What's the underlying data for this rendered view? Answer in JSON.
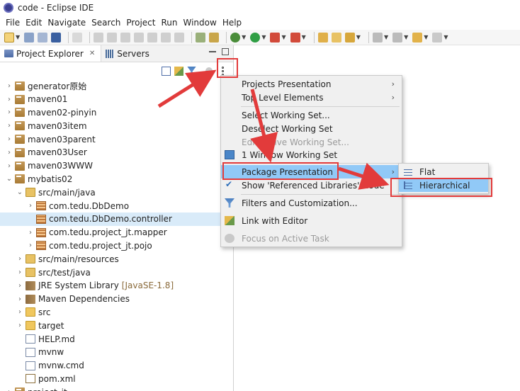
{
  "window": {
    "title": "code - Eclipse IDE"
  },
  "menubar": [
    "File",
    "Edit",
    "Navigate",
    "Search",
    "Project",
    "Run",
    "Window",
    "Help"
  ],
  "explorer": {
    "tabs": [
      {
        "label": "Project Explorer",
        "close": "✕"
      },
      {
        "label": "Servers"
      }
    ],
    "tree": [
      {
        "label": "generator原始",
        "indent": 0,
        "expander": "›",
        "icon": "project-icon"
      },
      {
        "label": "maven01",
        "indent": 0,
        "expander": "›",
        "icon": "project-icon"
      },
      {
        "label": "maven02-pinyin",
        "indent": 0,
        "expander": "›",
        "icon": "project-icon"
      },
      {
        "label": "maven03item",
        "indent": 0,
        "expander": "›",
        "icon": "project-icon"
      },
      {
        "label": "maven03parent",
        "indent": 0,
        "expander": "›",
        "icon": "project-icon"
      },
      {
        "label": "maven03User",
        "indent": 0,
        "expander": "›",
        "icon": "project-icon"
      },
      {
        "label": "maven03WWW",
        "indent": 0,
        "expander": "›",
        "icon": "project-icon"
      },
      {
        "label": "mybatis02",
        "indent": 0,
        "expander": "⌄",
        "icon": "project-icon"
      },
      {
        "label": "src/main/java",
        "indent": 1,
        "expander": "⌄",
        "icon": "source-folder-icon"
      },
      {
        "label": "com.tedu.DbDemo",
        "indent": 2,
        "expander": "›",
        "icon": "package-icon"
      },
      {
        "label": "com.tedu.DbDemo.controller",
        "indent": 2,
        "expander": "",
        "icon": "package-icon",
        "selected": true
      },
      {
        "label": "com.tedu.project_jt.mapper",
        "indent": 2,
        "expander": "›",
        "icon": "package-icon"
      },
      {
        "label": "com.tedu.project_jt.pojo",
        "indent": 2,
        "expander": "›",
        "icon": "package-icon"
      },
      {
        "label": "src/main/resources",
        "indent": 1,
        "expander": "›",
        "icon": "source-folder-icon"
      },
      {
        "label": "src/test/java",
        "indent": 1,
        "expander": "›",
        "icon": "source-folder-icon"
      },
      {
        "label": "JRE System Library",
        "suffix": "[JavaSE-1.8]",
        "indent": 1,
        "expander": "›",
        "icon": "library-icon"
      },
      {
        "label": "Maven Dependencies",
        "indent": 1,
        "expander": "›",
        "icon": "library-icon"
      },
      {
        "label": "src",
        "indent": 1,
        "expander": "›",
        "icon": "folder-icon"
      },
      {
        "label": "target",
        "indent": 1,
        "expander": "›",
        "icon": "folder-icon"
      },
      {
        "label": "HELP.md",
        "indent": 1,
        "expander": "",
        "icon": "file-icon"
      },
      {
        "label": "mvnw",
        "indent": 1,
        "expander": "",
        "icon": "file-icon"
      },
      {
        "label": "mvnw.cmd",
        "indent": 1,
        "expander": "",
        "icon": "file-icon"
      },
      {
        "label": "pom.xml",
        "indent": 1,
        "expander": "",
        "icon": "xml-file-icon"
      },
      {
        "label": "project_jt",
        "indent": 0,
        "expander": "›",
        "icon": "project-icon"
      }
    ]
  },
  "view_menu": {
    "items": {
      "projects_presentation": "Projects Presentation",
      "top_level_elements": "Top Level Elements",
      "select_working_set": "Select Working Set...",
      "deselect_working_set": "Deselect Working Set",
      "edit_active_working_set": "Edit Active Working Set...",
      "one_window_working_set": "1 Window Working Set",
      "package_presentation": "Package Presentation",
      "show_referenced_libraries": "Show 'Referenced Libraries' Node",
      "filters": "Filters and Customization...",
      "link_with_editor": "Link with Editor",
      "focus_on_active_task": "Focus on Active Task"
    },
    "submenu_arrow": "›",
    "check_mark": "✔"
  },
  "package_presentation_submenu": {
    "flat": "Flat",
    "hierarchical": "Hierarchical"
  },
  "colors": {
    "highlight": "#91c9f7",
    "selection": "#d9ebf9",
    "annotation_red": "#e23b3b"
  }
}
